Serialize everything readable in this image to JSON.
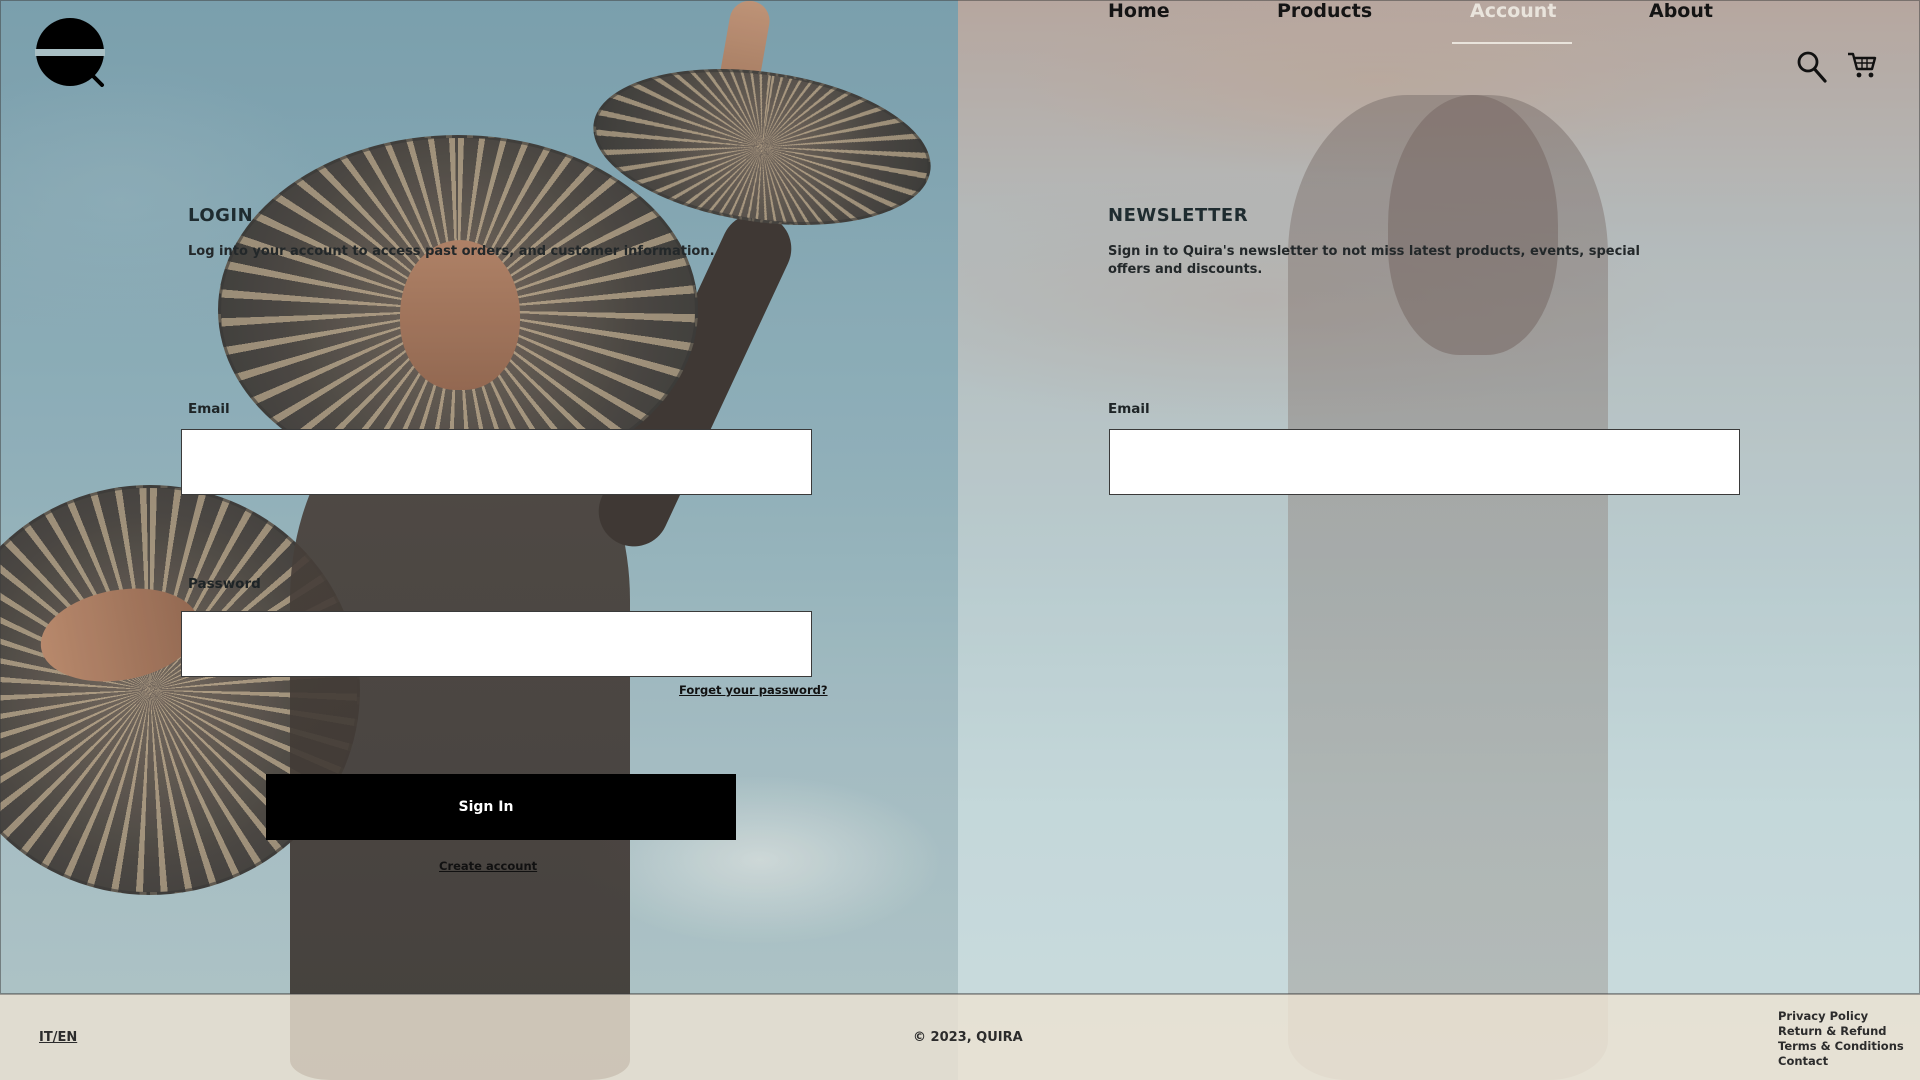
{
  "brand": {
    "logo_letter": "Q"
  },
  "nav": {
    "items": [
      {
        "label": "Home"
      },
      {
        "label": "Products"
      },
      {
        "label": "Account"
      },
      {
        "label": "About"
      }
    ],
    "active": "Account"
  },
  "icons": {
    "search": "search-icon",
    "cart": "cart-icon"
  },
  "login": {
    "title": "LOGIN",
    "description": "Log into your account to access past orders, and customer information.",
    "email_label": "Email",
    "email_value": "",
    "password_label": "Password",
    "password_value": "",
    "forgot_link": "Forget your password?",
    "submit_label": "Sign In",
    "create_account_link": "Create account"
  },
  "newsletter": {
    "title": "NEWSLETTER",
    "description": "Sign in to Quira's newsletter to not miss latest products, events, special offers and discounts.",
    "email_label": "Email",
    "email_value": ""
  },
  "footer": {
    "language": "IT/EN",
    "copyright": "© 2023, QUIRA",
    "links": [
      {
        "label": "Privacy Policy"
      },
      {
        "label": "Return & Refund"
      },
      {
        "label": "Terms & Conditions"
      },
      {
        "label": "Contact"
      }
    ]
  },
  "colors": {
    "primary_button_bg": "#000000",
    "active_nav": "#e9e4dc",
    "footer_bg": "#ece2d2"
  }
}
